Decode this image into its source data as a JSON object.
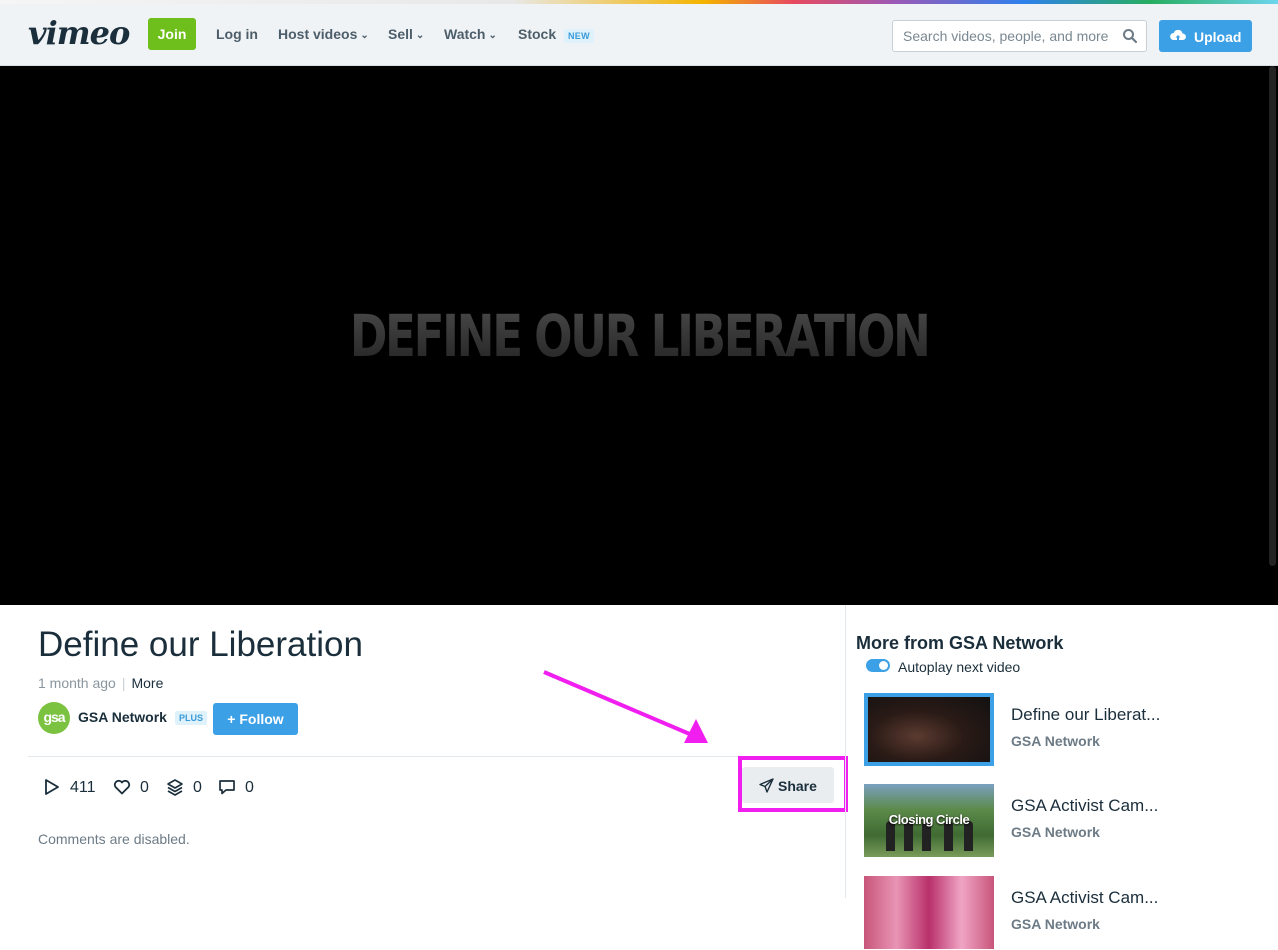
{
  "header": {
    "logo": "vimeo",
    "join_label": "Join",
    "nav": [
      {
        "label": "Log in"
      },
      {
        "label": "Host videos"
      },
      {
        "label": "Sell"
      },
      {
        "label": "Watch"
      },
      {
        "label": "Stock"
      }
    ],
    "stock_badge": "NEW",
    "search_placeholder": "Search videos, people, and more",
    "upload_label": "Upload",
    "icons": {
      "search": "search-icon",
      "upload": "cloud-upload-icon",
      "chevron": "chevron-down-icon"
    },
    "colors": {
      "join": "#6fbf1c",
      "accent": "#3ba0e6"
    }
  },
  "player": {
    "overlay_title": "DEFINE OUR LIBERATION"
  },
  "video": {
    "title": "Define our Liberation",
    "age": "1 month ago",
    "separator": "|",
    "more_label": "More",
    "channel_avatar": "gsa",
    "channel_name": "GSA Network",
    "channel_badge": "PLUS",
    "follow_label": "+ Follow",
    "stats": {
      "plays": "411",
      "likes": "0",
      "collections": "0",
      "comments": "0"
    },
    "share_label": "Share",
    "comments_note": "Comments are disabled."
  },
  "sidebar": {
    "title": "More from GSA Network",
    "autoplay_label": "Autoplay next video",
    "autoplay_on": true,
    "related": [
      {
        "title": "Define our Liberat...",
        "channel": "GSA Network"
      },
      {
        "title": "GSA Activist Cam...",
        "channel": "GSA Network",
        "thumb_caption": "Closing Circle"
      },
      {
        "title": "GSA Activist Cam...",
        "channel": "GSA Network"
      }
    ]
  },
  "annotation": {
    "color": "#f01ff0"
  }
}
